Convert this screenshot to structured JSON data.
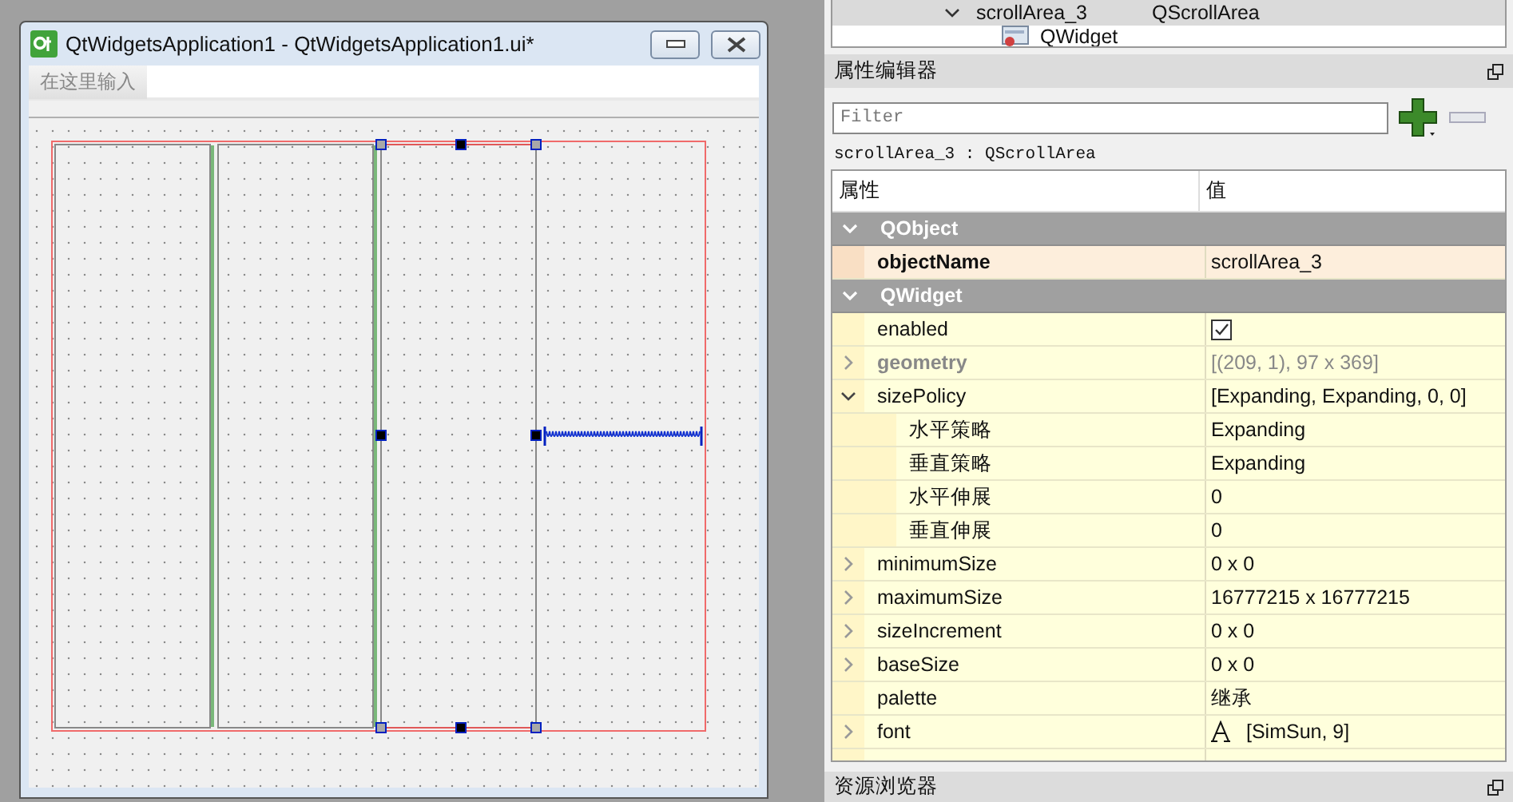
{
  "form_window": {
    "title": "QtWidgetsApplication1 - QtWidgetsApplication1.ui*",
    "menu_placeholder": "在这里输入",
    "widgets": [
      {
        "kind": "scroll_area",
        "selected": false
      },
      {
        "kind": "scroll_area",
        "selected": false
      },
      {
        "kind": "scroll_area",
        "selected": true
      },
      {
        "kind": "spacer",
        "selected": false
      }
    ]
  },
  "object_tree": {
    "rows": [
      {
        "name": "scrollArea_3",
        "class": "QScrollArea",
        "expanded": true
      },
      {
        "class": "QWidget",
        "expanded": false
      }
    ]
  },
  "property_editor": {
    "title": "属性编辑器",
    "filter": {
      "placeholder": "Filter"
    },
    "object_label": "scrollArea_3 : QScrollArea",
    "columns": [
      "属性",
      "值"
    ],
    "rows": [
      {
        "kind": "group",
        "name": "QObject",
        "expanded": true
      },
      {
        "kind": "text",
        "name": "objectName",
        "value": "scrollArea_3",
        "modified": true,
        "disabled": false,
        "selected": true
      },
      {
        "kind": "group",
        "name": "QWidget",
        "expanded": true
      },
      {
        "kind": "checkbox",
        "name": "enabled",
        "checked": true,
        "modified": false,
        "disabled": false,
        "selected": false
      },
      {
        "kind": "text",
        "name": "geometry",
        "value": "[(209, 1), 97 x 369]",
        "modified": true,
        "disabled": true,
        "selected": false,
        "expanded": false
      },
      {
        "kind": "text",
        "name": "sizePolicy",
        "value": "[Expanding, Expanding, 0, 0]",
        "modified": false,
        "disabled": false,
        "selected": false,
        "expanded": true,
        "children": [
          {
            "name": "水平策略",
            "value": "Expanding"
          },
          {
            "name": "垂直策略",
            "value": "Expanding"
          },
          {
            "name": "水平伸展",
            "value": "0"
          },
          {
            "name": "垂直伸展",
            "value": "0"
          }
        ]
      },
      {
        "kind": "text",
        "name": "minimumSize",
        "value": "0 x 0",
        "modified": false,
        "disabled": false,
        "selected": false,
        "expanded": false
      },
      {
        "kind": "text",
        "name": "maximumSize",
        "value": "16777215 x 16777215",
        "modified": false,
        "disabled": false,
        "selected": false,
        "expanded": false
      },
      {
        "kind": "text",
        "name": "sizeIncrement",
        "value": "0 x 0",
        "modified": false,
        "disabled": false,
        "selected": false,
        "expanded": false
      },
      {
        "kind": "text",
        "name": "baseSize",
        "value": "0 x 0",
        "modified": false,
        "disabled": false,
        "selected": false,
        "expanded": false
      },
      {
        "kind": "text",
        "name": "palette",
        "value": "继承",
        "modified": false,
        "disabled": false,
        "selected": false
      },
      {
        "kind": "font",
        "name": "font",
        "value": "[SimSun, 9]",
        "modified": false,
        "disabled": false,
        "selected": false,
        "expanded": false
      }
    ]
  },
  "resource_browser": {
    "title": "资源浏览器"
  }
}
